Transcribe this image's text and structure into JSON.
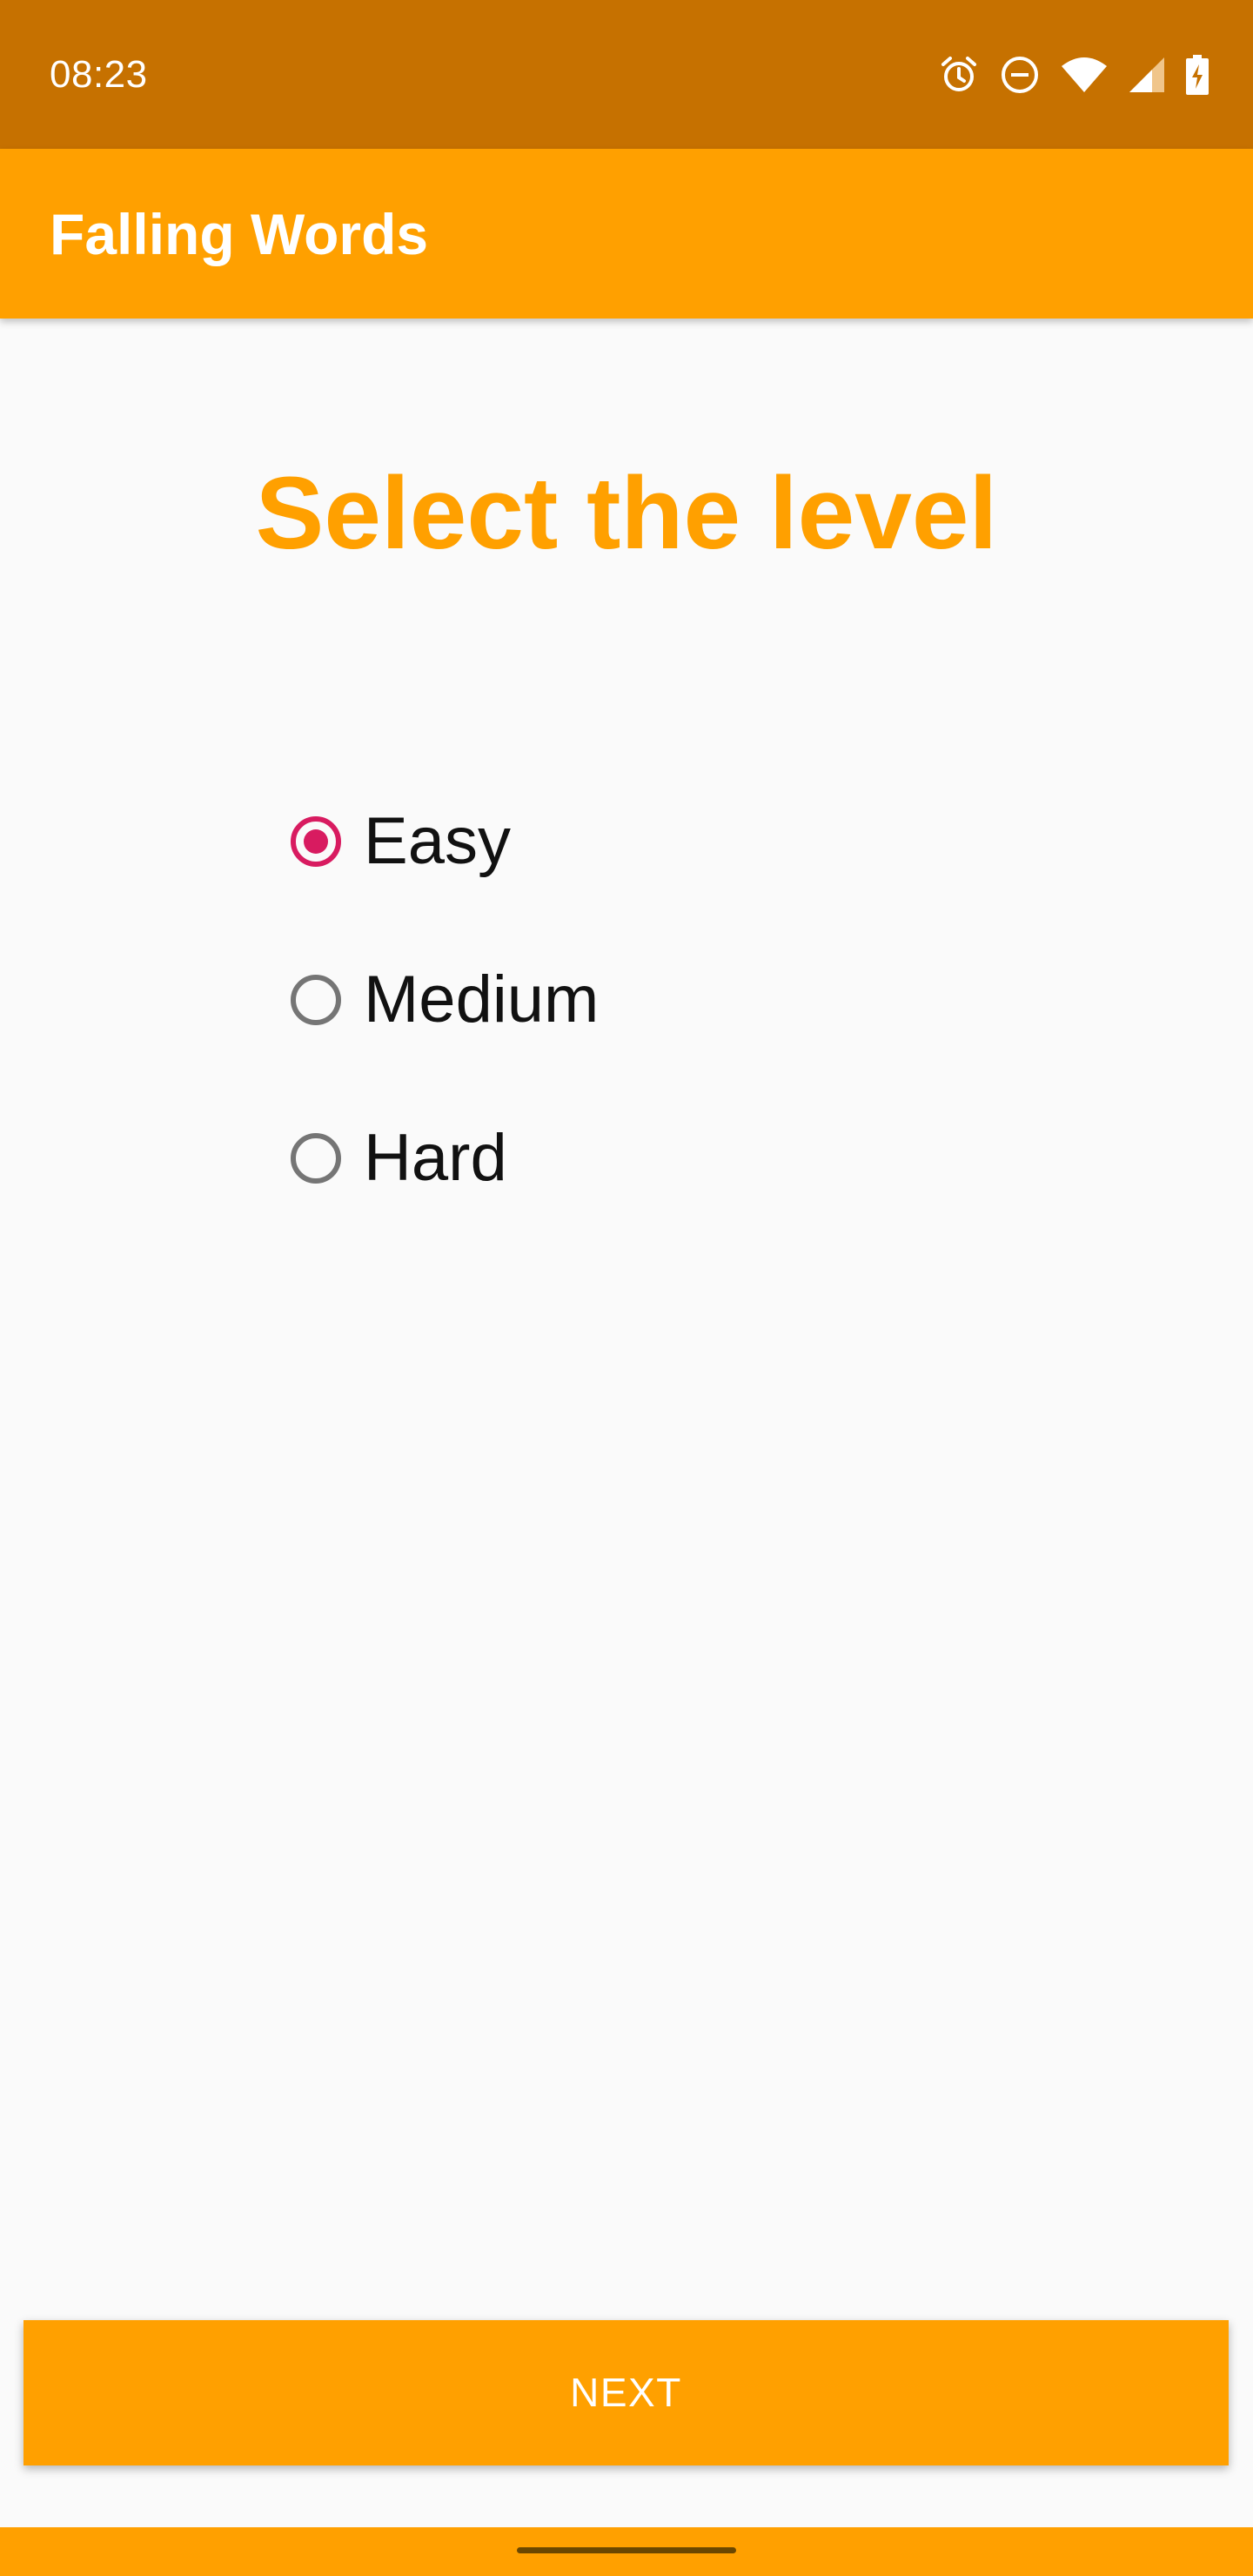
{
  "status_bar": {
    "time": "08:23",
    "icons": [
      "alarm-icon",
      "do-not-disturb-icon",
      "wifi-icon",
      "cell-signal-icon",
      "battery-charging-icon"
    ]
  },
  "app_bar": {
    "title": "Falling Words"
  },
  "main": {
    "heading": "Select the level",
    "levels": [
      {
        "label": "Easy",
        "checked": true
      },
      {
        "label": "Medium",
        "checked": false
      },
      {
        "label": "Hard",
        "checked": false
      }
    ],
    "next_label": "NEXT"
  },
  "colors": {
    "status_bar": "#c67100",
    "primary": "#ffa000",
    "accent": "#d81b60",
    "background": "#fafafa"
  }
}
